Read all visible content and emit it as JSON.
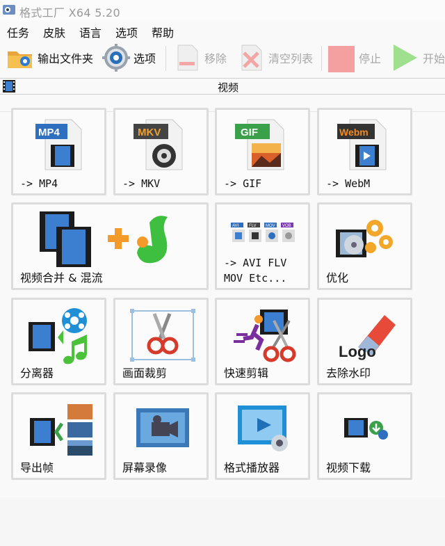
{
  "titlebar": {
    "title": "格式工厂 X64 5.20"
  },
  "menu": {
    "items": [
      "任务",
      "皮肤",
      "语言",
      "选项",
      "帮助"
    ]
  },
  "toolbar": {
    "output_folder": "输出文件夹",
    "options": "选项",
    "remove": "移除",
    "clear_list": "清空列表",
    "stop": "停止",
    "start": "开始"
  },
  "category": {
    "label": "视频"
  },
  "tiles": {
    "mp4": {
      "badge": "MP4",
      "label": "-> MP4"
    },
    "mkv": {
      "badge": "MKV",
      "label": "-> MKV"
    },
    "gif": {
      "badge": "GIF",
      "label": "-> GIF"
    },
    "webm": {
      "badge": "Webm",
      "label": "-> WebM"
    },
    "merge": {
      "label": "视频合并 & 混流"
    },
    "avi": {
      "label": "-> AVI FLV\nMOV Etc...",
      "mini_badges": [
        "AVI",
        "FLV",
        "MOV",
        "VOB"
      ]
    },
    "optimize": {
      "label": "优化"
    },
    "splitter": {
      "label": "分离器"
    },
    "crop": {
      "label": "画面裁剪"
    },
    "quickcut": {
      "label": "快速剪辑"
    },
    "watermark": {
      "label": "去除水印",
      "logo_text": "Logo"
    },
    "frames": {
      "label": "导出帧"
    },
    "record": {
      "label": "屏幕录像"
    },
    "player": {
      "label": "格式播放器"
    },
    "download": {
      "label": "视频下载"
    }
  },
  "colors": {
    "mp4_badge": "#2e6fbf",
    "mkv_badge": "#444444",
    "mkv_badge_text": "#f0a030",
    "gif_badge": "#3aa14a",
    "webm_badge": "#333333",
    "webm_badge_text": "#f08a20",
    "stop_square": "#f4a0a0",
    "start_arrow": "#9fe08f",
    "film": "#2a6ab5"
  },
  "icons": {
    "toolbar": [
      "folder-icon",
      "options-gear-icon",
      "remove-doc-icon",
      "clear-list-icon",
      "stop-icon",
      "start-icon"
    ]
  }
}
